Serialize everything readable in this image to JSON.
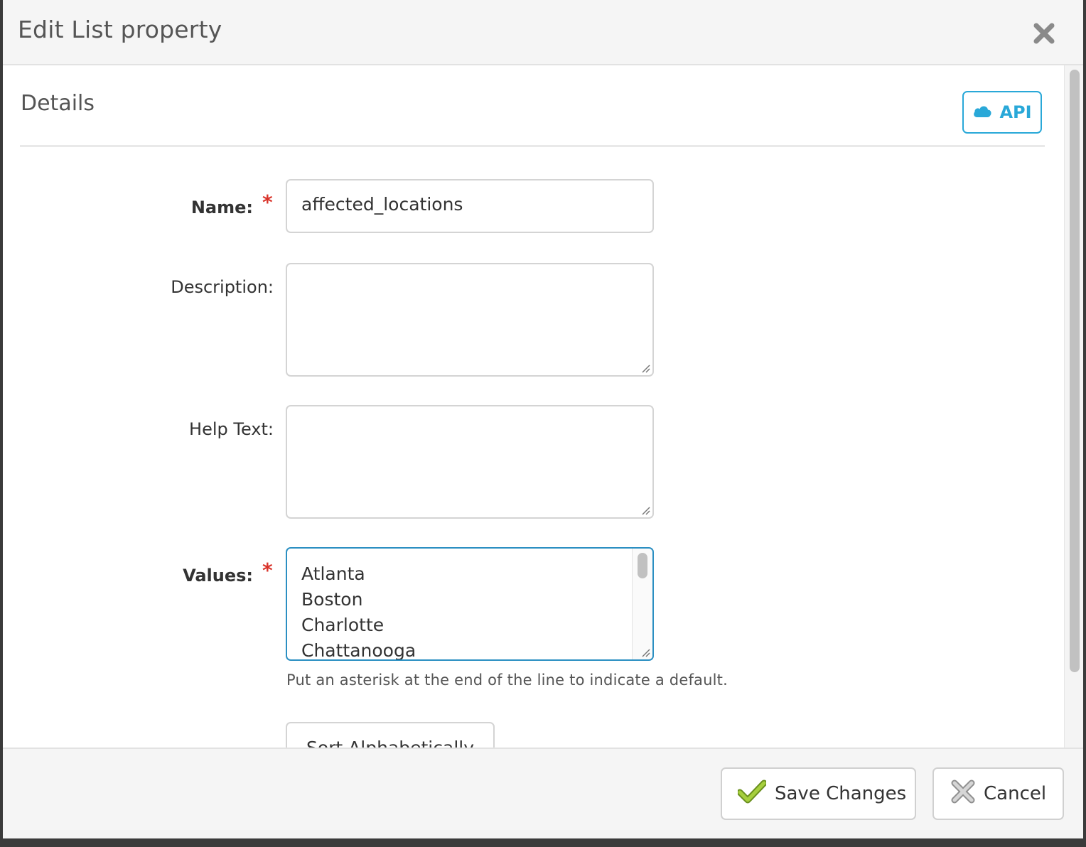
{
  "dialog": {
    "title": "Edit List property"
  },
  "details": {
    "section_title": "Details",
    "api_label": "API"
  },
  "form": {
    "name_label": "Name:",
    "name_value": "affected_locations",
    "description_label": "Description:",
    "description_value": "",
    "help_label": "Help Text:",
    "help_value": "",
    "values_label": "Values:",
    "values": [
      "Atlanta",
      "Boston",
      "Charlotte",
      "Chattanooga"
    ],
    "hint": "Put an asterisk at the end of the line to indicate a default.",
    "sort_label": "Sort Alphabetically",
    "required_marker": "*"
  },
  "footer": {
    "save_label": "Save Changes",
    "cancel_label": "Cancel"
  },
  "colors": {
    "accent": "#29a8d8",
    "required": "#d9342b",
    "focus_border": "#2b8fc2"
  }
}
